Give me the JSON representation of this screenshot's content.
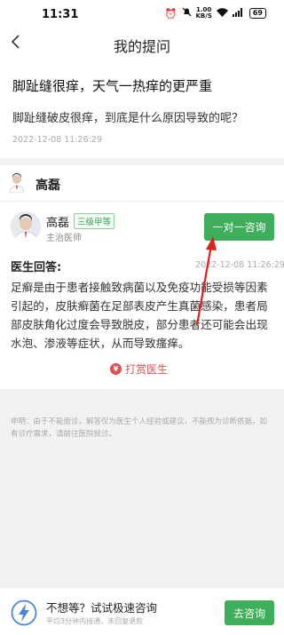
{
  "status_bar": {
    "time": "11:31",
    "net_speed_top": "1.00",
    "net_speed_bottom": "KB/S",
    "battery": "69"
  },
  "nav": {
    "title": "我的提问"
  },
  "question": {
    "title": "脚趾缝很痒，天气一热痒的更严重",
    "body": "脚趾缝破皮很痒，到底是什么原因导致的呢？",
    "time": "2022-12-08 11:26:29"
  },
  "doctor": {
    "name": "高磊",
    "hospital_level": "三级甲等",
    "role": "主治医师",
    "consult_label": "一对一咨询"
  },
  "reply": {
    "label": "医生回答:",
    "time": "2022-12-08 11:26:29",
    "text": "足癣是由于患者接触致病菌以及免疫功能受损等因素引起的，皮肤癣菌在足部表皮产生真菌感染，患者局部皮肤角化过度会导致脱皮，部分患者还可能会出现水泡、渗液等症状，从而导致瘙痒。",
    "tip_icon": "¥",
    "tip_label": "打赏医生"
  },
  "disclaimer": "申明：由于不能面诊，解答仅为医生个人经验或建议，不能视为诊断依据，如有诊疗需求，请前往医院就诊。",
  "bottom": {
    "title": "不想等？试试极速咨询",
    "subtitle": "平均3分钟内接通，未回复退款",
    "go_label": "去咨询"
  },
  "colors": {
    "accent_green": "#3fae5b",
    "tip_red": "#e0504f",
    "arrow_red": "#e0201a"
  }
}
